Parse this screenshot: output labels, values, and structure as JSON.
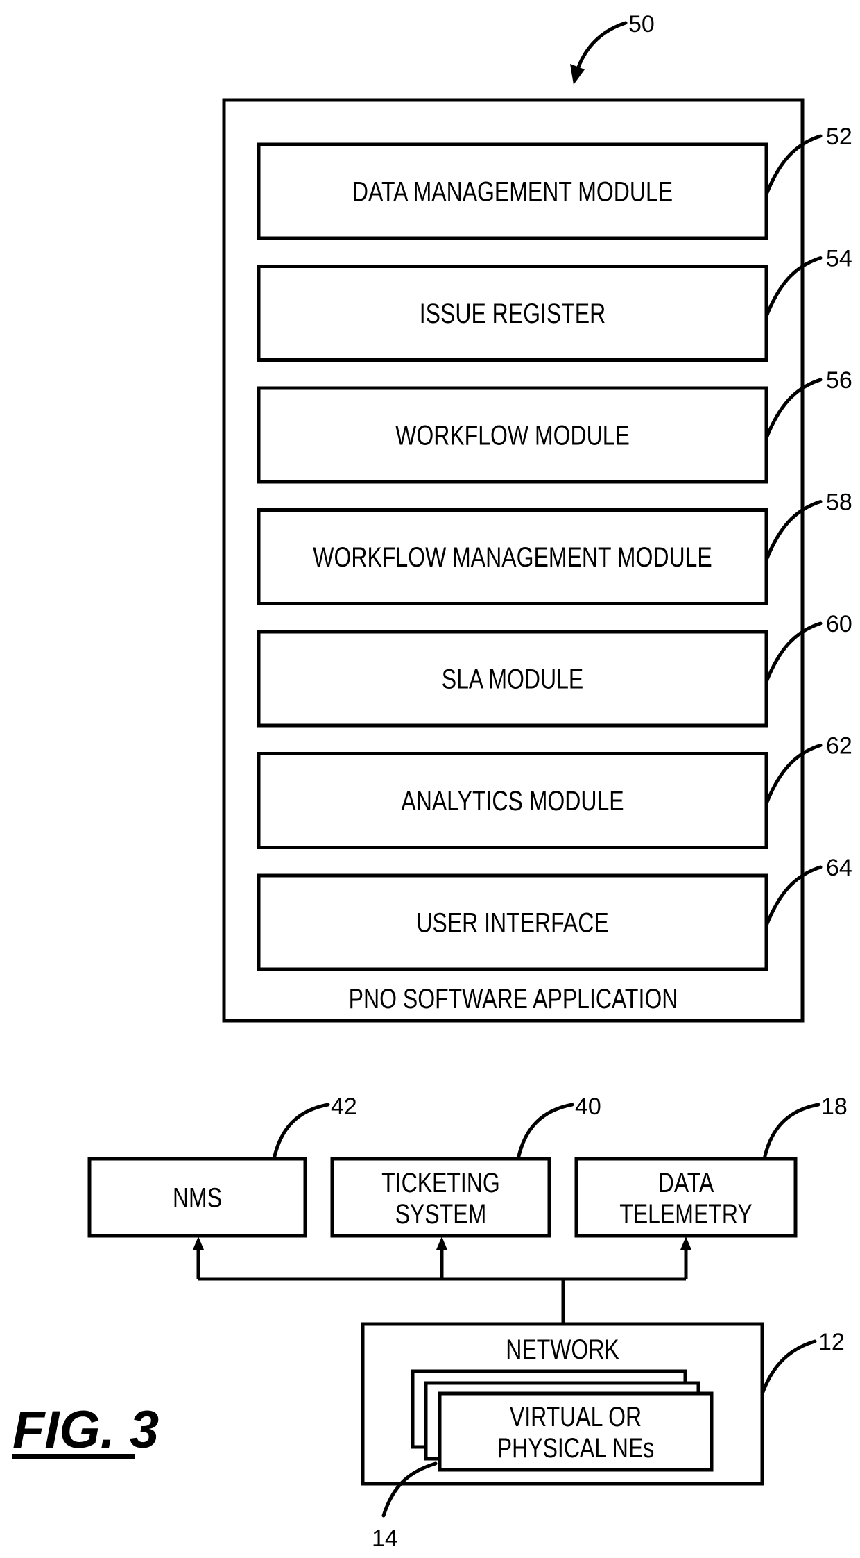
{
  "figure": {
    "label": "FIG. 3",
    "ref": "50"
  },
  "pno_app": {
    "title": "PNO SOFTWARE APPLICATION",
    "modules": [
      {
        "label": "DATA MANAGEMENT MODULE",
        "ref": "52"
      },
      {
        "label": "ISSUE REGISTER",
        "ref": "54"
      },
      {
        "label": "WORKFLOW MODULE",
        "ref": "56"
      },
      {
        "label": "WORKFLOW MANAGEMENT MODULE",
        "ref": "58"
      },
      {
        "label": "SLA MODULE",
        "ref": "60"
      },
      {
        "label": "ANALYTICS MODULE",
        "ref": "62"
      },
      {
        "label": "USER INTERFACE",
        "ref": "64"
      }
    ]
  },
  "systems": [
    {
      "lines": [
        "NMS"
      ],
      "ref": "42"
    },
    {
      "lines": [
        "TICKETING",
        "SYSTEM"
      ],
      "ref": "40"
    },
    {
      "lines": [
        "DATA",
        "TELEMETRY"
      ],
      "ref": "18"
    }
  ],
  "network": {
    "title": "NETWORK",
    "ref": "12",
    "elements": {
      "lines": [
        "VIRTUAL OR",
        "PHYSICAL NEs"
      ],
      "ref": "14"
    }
  }
}
